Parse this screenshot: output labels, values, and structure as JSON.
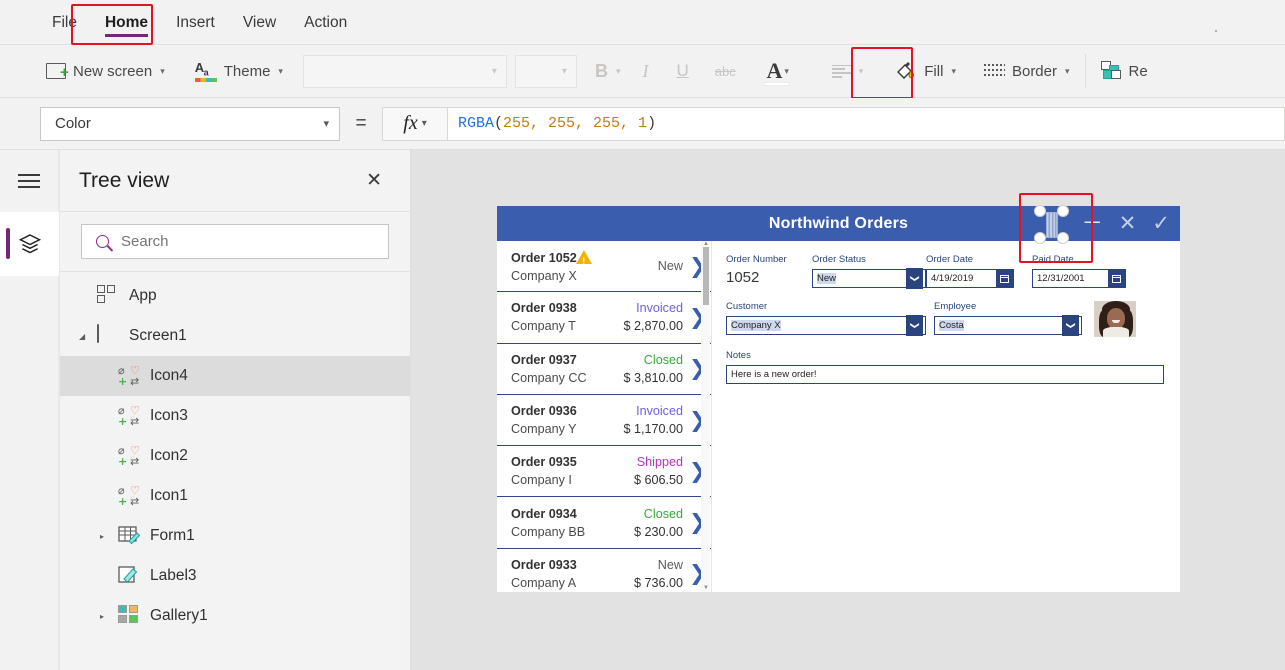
{
  "menu": {
    "items": [
      {
        "label": "File",
        "active": false
      },
      {
        "label": "Home",
        "active": true
      },
      {
        "label": "Insert",
        "active": false
      },
      {
        "label": "View",
        "active": false
      },
      {
        "label": "Action",
        "active": false
      }
    ],
    "active_tab_underline_color": "#742774",
    "highlight_color": "#e81123"
  },
  "toolbar": {
    "new_screen_label": "New screen",
    "theme_label": "Theme",
    "font_family_value": "",
    "font_size_value": "",
    "bold_label": "B",
    "italic_label": "I",
    "underline_label": "U",
    "strikethrough_label": "abc",
    "font_color_label": "A",
    "font_color_swatch": "#ffffff",
    "align_label": "",
    "fill_label": "Fill",
    "border_label": "Border",
    "reorder_label": "Re"
  },
  "formula_bar": {
    "property": "Color",
    "equals": "=",
    "fx_label": "fx",
    "formula_fn": "RGBA",
    "formula_open": "(",
    "formula_args": "255, 255, 255, 1",
    "formula_close": ")",
    "formula_full": "RGBA(255, 255, 255, 1)"
  },
  "tree_panel": {
    "title": "Tree view",
    "close_label": "✕",
    "search_placeholder": "Search",
    "search_value": "",
    "nodes": [
      {
        "label": "App",
        "indent": 0,
        "twist": "",
        "icon": "app-icon",
        "selected": false
      },
      {
        "label": "Screen1",
        "indent": 0,
        "twist": "◢",
        "icon": "screen-icon",
        "selected": false
      },
      {
        "label": "Icon4",
        "indent": 2,
        "twist": "",
        "icon": "icon-control-icon",
        "selected": true
      },
      {
        "label": "Icon3",
        "indent": 2,
        "twist": "",
        "icon": "icon-control-icon",
        "selected": false
      },
      {
        "label": "Icon2",
        "indent": 2,
        "twist": "",
        "icon": "icon-control-icon",
        "selected": false
      },
      {
        "label": "Icon1",
        "indent": 2,
        "twist": "",
        "icon": "icon-control-icon",
        "selected": false
      },
      {
        "label": "Form1",
        "indent": 1,
        "twist": "▸",
        "icon": "form-icon",
        "selected": false
      },
      {
        "label": "Label3",
        "indent": 2,
        "twist": "",
        "icon": "label-icon",
        "selected": false
      },
      {
        "label": "Gallery1",
        "indent": 1,
        "twist": "▸",
        "icon": "gallery-icon",
        "selected": false
      }
    ]
  },
  "app_preview": {
    "header_title": "Northwind Orders",
    "header_color": "#3a5dae",
    "header_actions": [
      {
        "name": "new-record-icon",
        "glyph": "＋"
      },
      {
        "name": "cancel-icon",
        "glyph": "✕"
      },
      {
        "name": "save-icon",
        "glyph": "✓"
      }
    ],
    "selected_control_name": "Icon4",
    "gallery": {
      "rows": [
        {
          "order": "Order 1052",
          "company": "Company X",
          "status": "New",
          "status_color": "#5c5c5c",
          "amount": "",
          "warning": true
        },
        {
          "order": "Order 0938",
          "company": "Company T",
          "status": "Invoiced",
          "status_color": "#6c63d8",
          "amount": "$ 2,870.00",
          "warning": false
        },
        {
          "order": "Order 0937",
          "company": "Company CC",
          "status": "Closed",
          "status_color": "#3aa93a",
          "amount": "$ 3,810.00",
          "warning": false
        },
        {
          "order": "Order 0936",
          "company": "Company Y",
          "status": "Invoiced",
          "status_color": "#6c63d8",
          "amount": "$ 1,170.00",
          "warning": false
        },
        {
          "order": "Order 0935",
          "company": "Company I",
          "status": "Shipped",
          "status_color": "#c42ec4",
          "amount": "$ 606.50",
          "warning": false
        },
        {
          "order": "Order 0934",
          "company": "Company BB",
          "status": "Closed",
          "status_color": "#3aa93a",
          "amount": "$ 230.00",
          "warning": false
        },
        {
          "order": "Order 0933",
          "company": "Company A",
          "status": "New",
          "status_color": "#5c5c5c",
          "amount": "$ 736.00",
          "warning": false
        }
      ]
    },
    "form": {
      "order_number_label": "Order Number",
      "order_number_value": "1052",
      "order_status_label": "Order Status",
      "order_status_value": "New",
      "order_date_label": "Order Date",
      "order_date_value": "4/19/2019",
      "paid_date_label": "Paid Date",
      "paid_date_value": "12/31/2001",
      "customer_label": "Customer",
      "customer_value": "Company X",
      "employee_label": "Employee",
      "employee_value": "Costa",
      "notes_label": "Notes",
      "notes_value": "Here is a new order!"
    }
  }
}
